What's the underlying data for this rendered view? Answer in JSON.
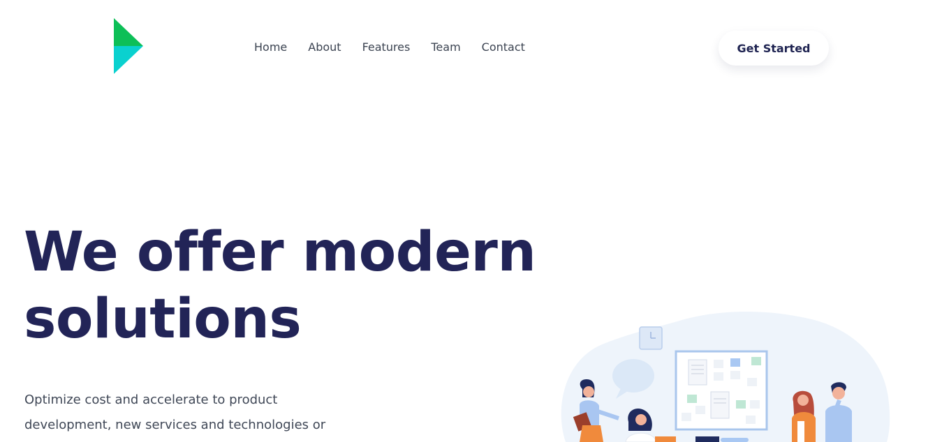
{
  "header": {
    "logo_icon": "triangle-logo-icon",
    "nav": [
      {
        "label": "Home"
      },
      {
        "label": "About"
      },
      {
        "label": "Features"
      },
      {
        "label": "Team"
      },
      {
        "label": "Contact"
      }
    ],
    "cta_label": "Get Started"
  },
  "hero": {
    "title_line1": "We offer modern",
    "title_line2": "solutions",
    "description": "Optimize cost and accelerate to product development, new services and technologies or"
  },
  "colors": {
    "brand_dark": "#222457",
    "logo_green": "#0dbf57",
    "logo_cyan": "#0ad1cf",
    "text_body": "#3f4756",
    "illustration_blob": "#eef4fb"
  },
  "illustration": {
    "icon": "team-planning-illustration"
  }
}
